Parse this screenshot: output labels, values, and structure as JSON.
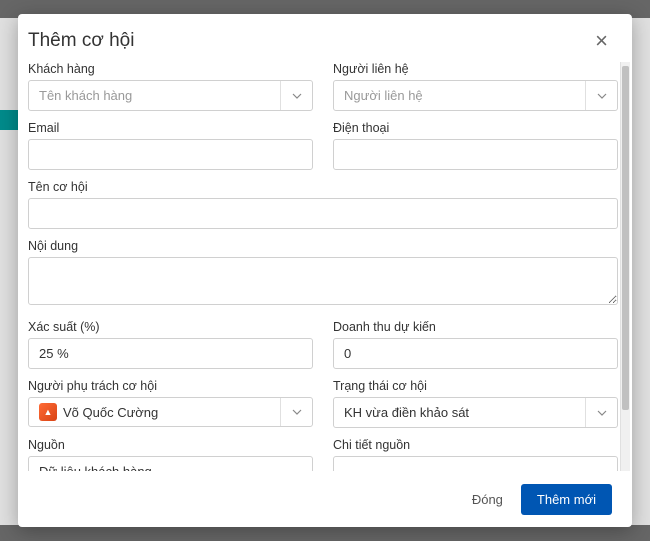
{
  "modal": {
    "title": "Thêm cơ hội"
  },
  "fields": {
    "customer": {
      "label": "Khách hàng",
      "placeholder": "Tên khách hàng"
    },
    "contact": {
      "label": "Người liên hệ",
      "placeholder": "Người liên hệ"
    },
    "email": {
      "label": "Email",
      "value": ""
    },
    "phone": {
      "label": "Điện thoại",
      "value": ""
    },
    "opportunityName": {
      "label": "Tên cơ hội",
      "value": ""
    },
    "content": {
      "label": "Nội dung",
      "value": ""
    },
    "probability": {
      "label": "Xác suất (%)",
      "value": "25 %"
    },
    "revenue": {
      "label": "Doanh thu dự kiến",
      "value": "0"
    },
    "assignee": {
      "label": "Người phụ trách cơ hội",
      "value": "Võ Quốc Cường"
    },
    "status": {
      "label": "Trạng thái cơ hội",
      "value": "KH vừa điền khảo sát"
    },
    "source": {
      "label": "Nguồn",
      "value": "Dữ liệu khách hàng"
    },
    "sourceDetail": {
      "label": "Chi tiết nguồn",
      "value": ""
    }
  },
  "footer": {
    "close": "Đóng",
    "submit": "Thêm mới"
  }
}
